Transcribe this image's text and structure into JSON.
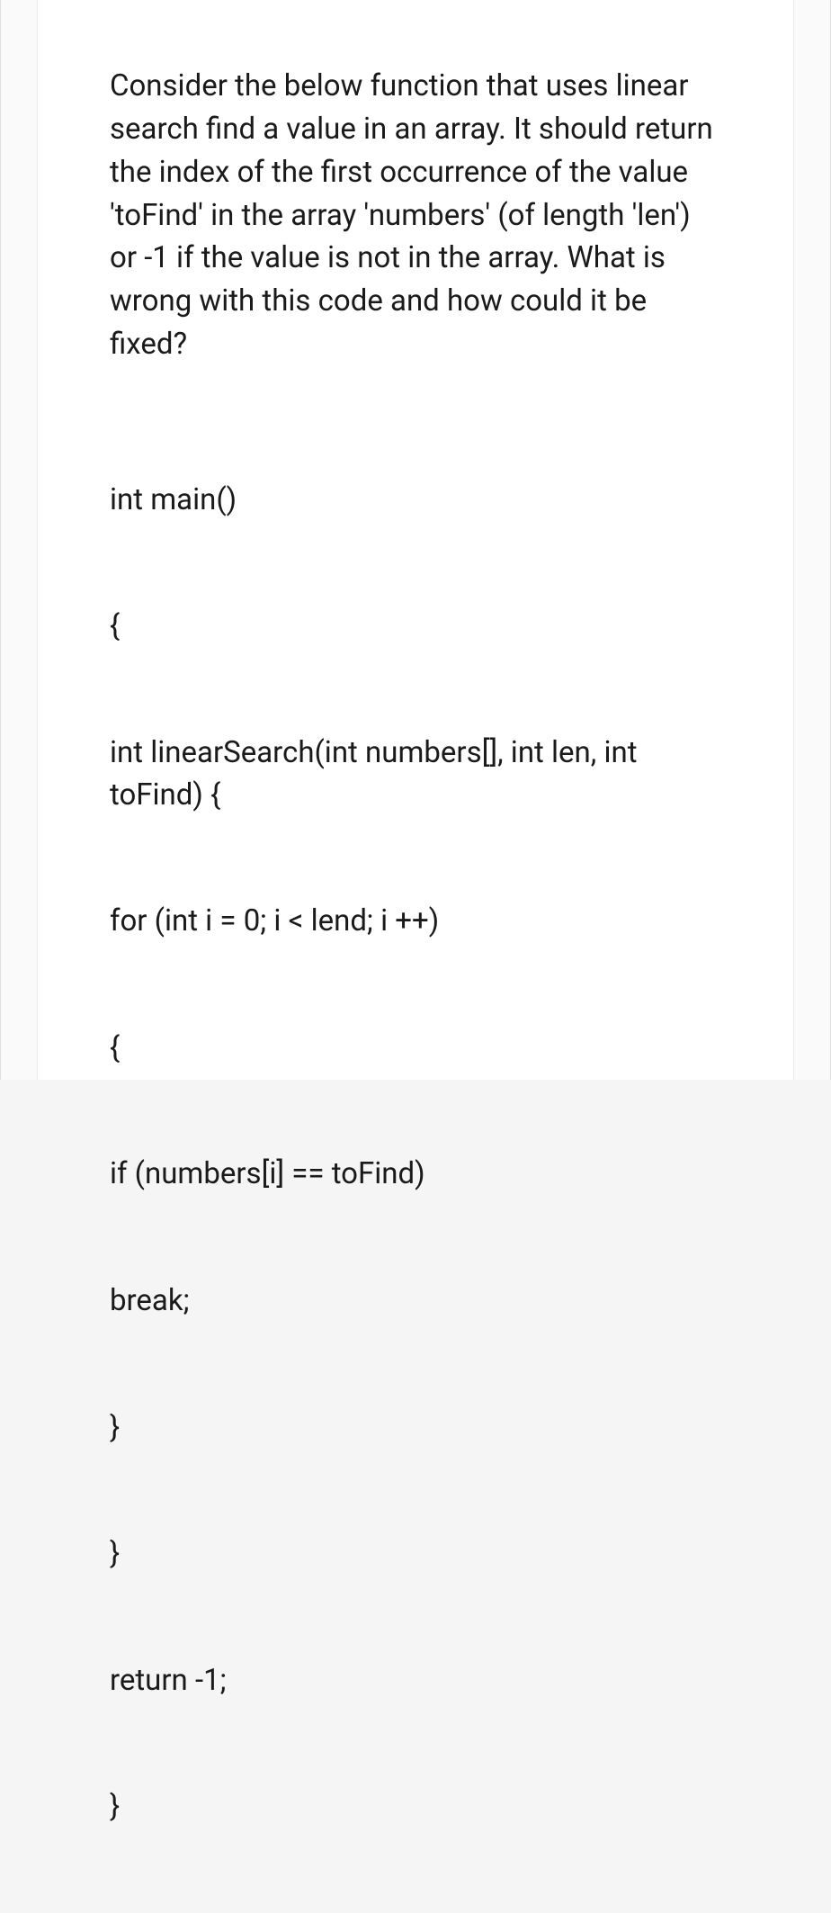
{
  "question": {
    "prompt": "Consider the below function that uses linear search find a value in an array. It should return the index of the first occurrence of the value 'toFind' in the array 'numbers' (of length 'len') or -1 if the value is not in the array. What is wrong with this code and how could it be fixed?",
    "code_lines": [
      "int main()",
      "{",
      "int linearSearch(int numbers[], int len, int toFind) {",
      "for (int i = 0; i < lend; i ++)",
      "{",
      "if (numbers[i] == toFind)",
      "break;",
      "}",
      "}",
      "return -1;",
      "}"
    ]
  }
}
